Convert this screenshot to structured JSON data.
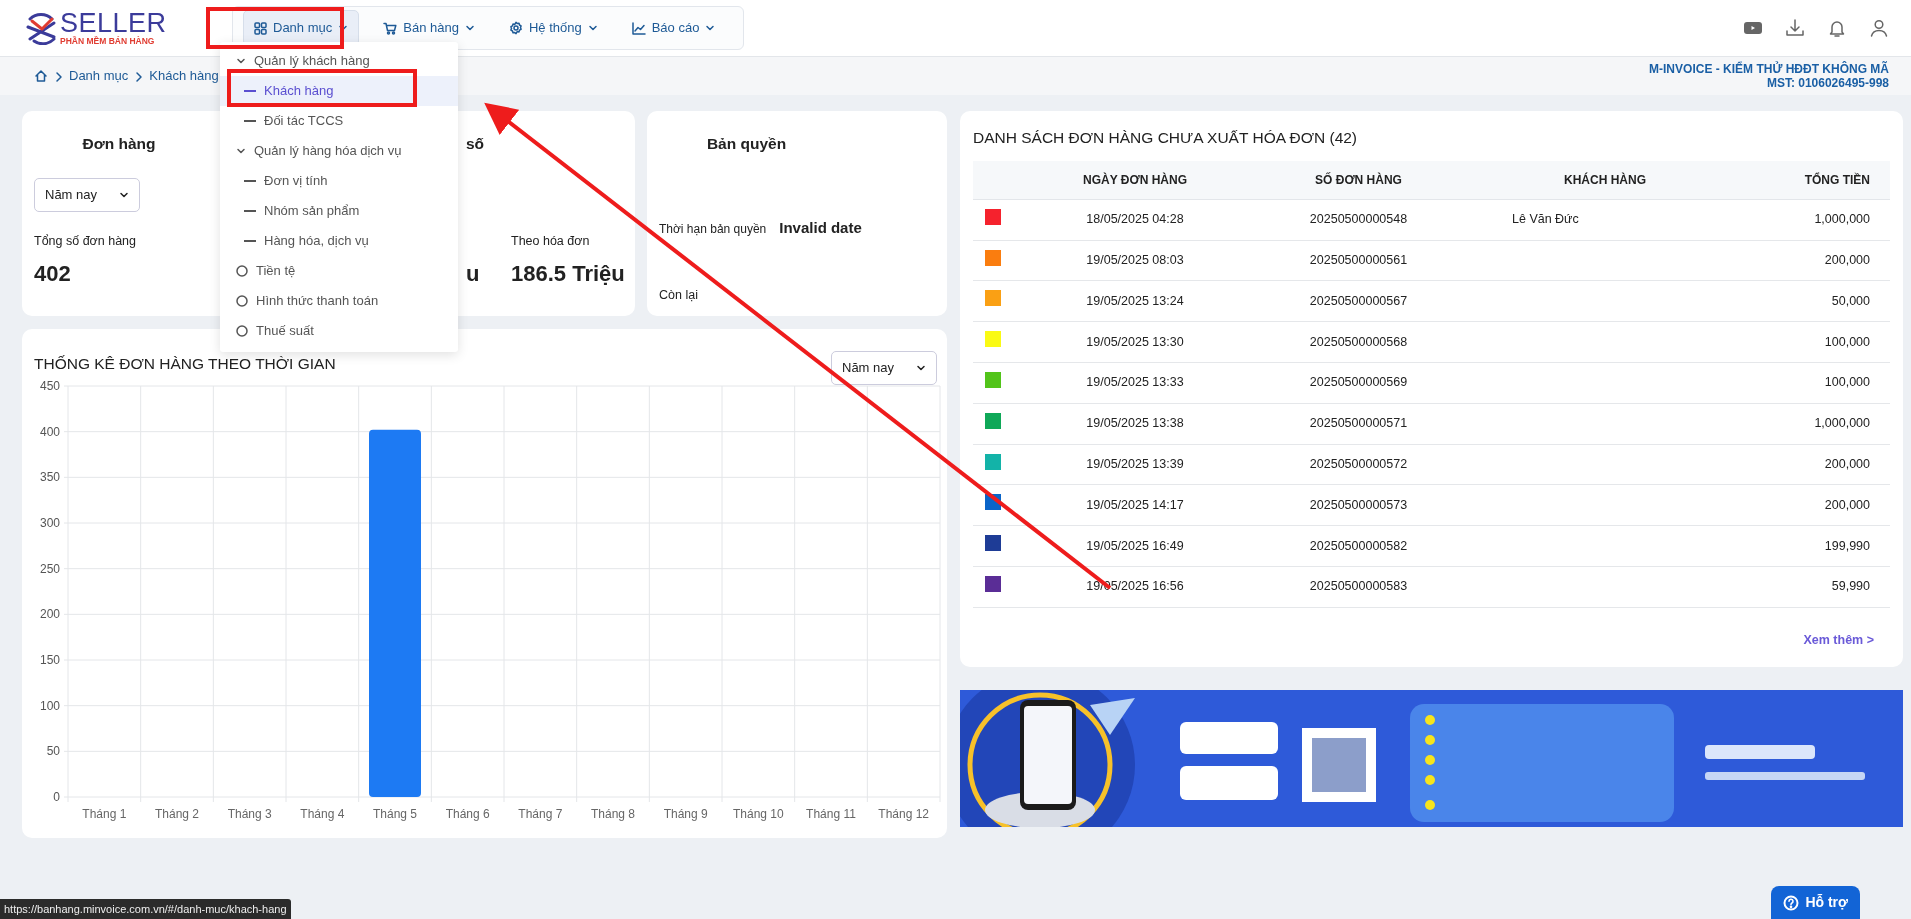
{
  "header": {
    "logo": {
      "name": "SELLER",
      "tagline": "PHẦN MỀM BÁN HÀNG"
    },
    "nav": [
      {
        "label": "Danh mục",
        "selected": true
      },
      {
        "label": "Bán hàng",
        "selected": false
      },
      {
        "label": "Hệ thống",
        "selected": false
      },
      {
        "label": "Báo cáo",
        "selected": false
      }
    ]
  },
  "menu": [
    {
      "label": "Quản lý khách hàng",
      "kind": "group",
      "expanded": true,
      "children": [
        {
          "label": "Khách hàng",
          "selected": true
        },
        {
          "label": "Đối tác TCCS",
          "selected": false
        }
      ]
    },
    {
      "label": "Quản lý hàng hóa dịch vụ",
      "kind": "group",
      "expanded": true,
      "children": [
        {
          "label": "Đơn vị tính",
          "selected": false
        },
        {
          "label": "Nhóm sản phẩm",
          "selected": false
        },
        {
          "label": "Hàng hóa, dịch vụ",
          "selected": false
        }
      ]
    },
    {
      "label": "Tiền tệ",
      "kind": "item",
      "selected": false
    },
    {
      "label": "Hình thức thanh toán",
      "kind": "item",
      "selected": false
    },
    {
      "label": "Thuế suất",
      "kind": "item",
      "selected": false
    }
  ],
  "breadcrumb": [
    "Danh mục",
    "Khách hàng"
  ],
  "company": {
    "name": "M-INVOICE - KIỂM THỬ HĐĐT KHÔNG MÃ",
    "tax_id": "MST: 0106026495-998"
  },
  "order_card": {
    "title": "Đơn hàng",
    "period": "Năm nay",
    "total_label": "Tổng số đơn hàng",
    "total": "402",
    "title_2": "số",
    "value_2": "u",
    "label_3": "Theo hóa đơn",
    "value_3": "186.5 Triệu"
  },
  "license_card": {
    "title": "Bản quyền",
    "expiry_label": "Thời hạn bản quyền",
    "expiry_value": "Invalid date",
    "remaining_label": "Còn lại"
  },
  "orders_chart": {
    "title": "THỐNG KÊ ĐƠN HÀNG THEO THỜI GIAN",
    "period": "Năm nay",
    "chart_data": {
      "type": "bar",
      "categories": [
        "Tháng 1",
        "Tháng 2",
        "Tháng 3",
        "Tháng 4",
        "Tháng 5",
        "Tháng 6",
        "Tháng 7",
        "Tháng 8",
        "Tháng 9",
        "Tháng 10",
        "Tháng 11",
        "Tháng 12"
      ],
      "grid": true,
      "series": [
        {
          "color": "#1d7af3",
          "values": [
            0,
            0,
            0,
            0,
            402,
            0,
            0,
            0,
            0,
            0,
            0,
            0
          ]
        }
      ],
      "ylim": [
        0,
        450
      ],
      "yticks": [
        0,
        50,
        100,
        150,
        200,
        250,
        300,
        350,
        400,
        450
      ]
    }
  },
  "orders_table": {
    "title": "DANH SÁCH ĐƠN HÀNG CHƯA XUẤT HÓA ĐƠN (42)",
    "columns": [
      "NGÀY ĐƠN HÀNG",
      "SỐ ĐƠN HÀNG",
      "KHÁCH HÀNG",
      "TỔNG TIỀN"
    ],
    "rows": [
      {
        "color": "#f5222d",
        "date": "18/05/2025 04:28",
        "number": "20250500000548",
        "customer": "Lê Văn Đức",
        "total": "1,000,000"
      },
      {
        "color": "#fa7d0f",
        "date": "19/05/2025 08:03",
        "number": "20250500000561",
        "total": "200,000"
      },
      {
        "color": "#faa014",
        "date": "19/05/2025 13:24",
        "number": "20250500000567",
        "total": "50,000"
      },
      {
        "color": "#fafa14",
        "date": "19/05/2025 13:30",
        "number": "20250500000568",
        "total": "100,000"
      },
      {
        "color": "#52c41a",
        "date": "19/05/2025 13:33",
        "number": "20250500000569",
        "total": "100,000"
      },
      {
        "color": "#0fa858",
        "date": "19/05/2025 13:38",
        "number": "20250500000571",
        "total": "1,000,000"
      },
      {
        "color": "#13b3a8",
        "date": "19/05/2025 13:39",
        "number": "20250500000572",
        "total": "200,000"
      },
      {
        "color": "#0a64c8",
        "date": "19/05/2025 14:17",
        "number": "20250500000573",
        "total": "200,000"
      },
      {
        "color": "#1e3c96",
        "date": "19/05/2025 16:49",
        "number": "20250500000582",
        "total": "199,990"
      },
      {
        "color": "#5a2d96",
        "date": "19/05/2025 16:56",
        "number": "20250500000583",
        "total": "59,990"
      }
    ],
    "more_link": "Xem thêm >"
  },
  "status_url": "https://banhang.minvoice.com.vn/#/danh-muc/khach-hang",
  "support_button": "Hỗ trợ"
}
